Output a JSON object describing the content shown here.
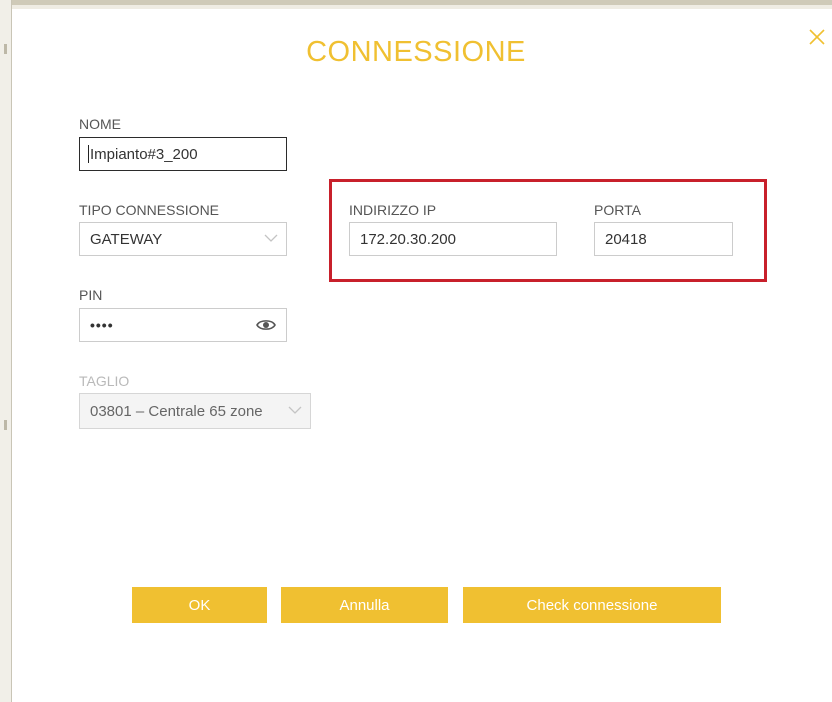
{
  "dialog": {
    "title": "CONNESSIONE",
    "close_icon": "close-icon"
  },
  "fields": {
    "nome": {
      "label": "NOME",
      "value": "Impianto#3_200"
    },
    "tipo_connessione": {
      "label": "TIPO CONNESSIONE",
      "value": "GATEWAY"
    },
    "pin": {
      "label": "PIN",
      "value": "••••",
      "icon": "eye-icon"
    },
    "taglio": {
      "label": "TAGLIO",
      "value": "03801 – Centrale 65 zone",
      "disabled": true
    },
    "indirizzo_ip": {
      "label": "INDIRIZZO IP",
      "value": "172.20.30.200"
    },
    "porta": {
      "label": "PORTA",
      "value": "20418"
    }
  },
  "buttons": {
    "ok": "OK",
    "annulla": "Annulla",
    "check": "Check connessione"
  },
  "colors": {
    "accent": "#f0c031",
    "highlight": "#c8202b"
  }
}
